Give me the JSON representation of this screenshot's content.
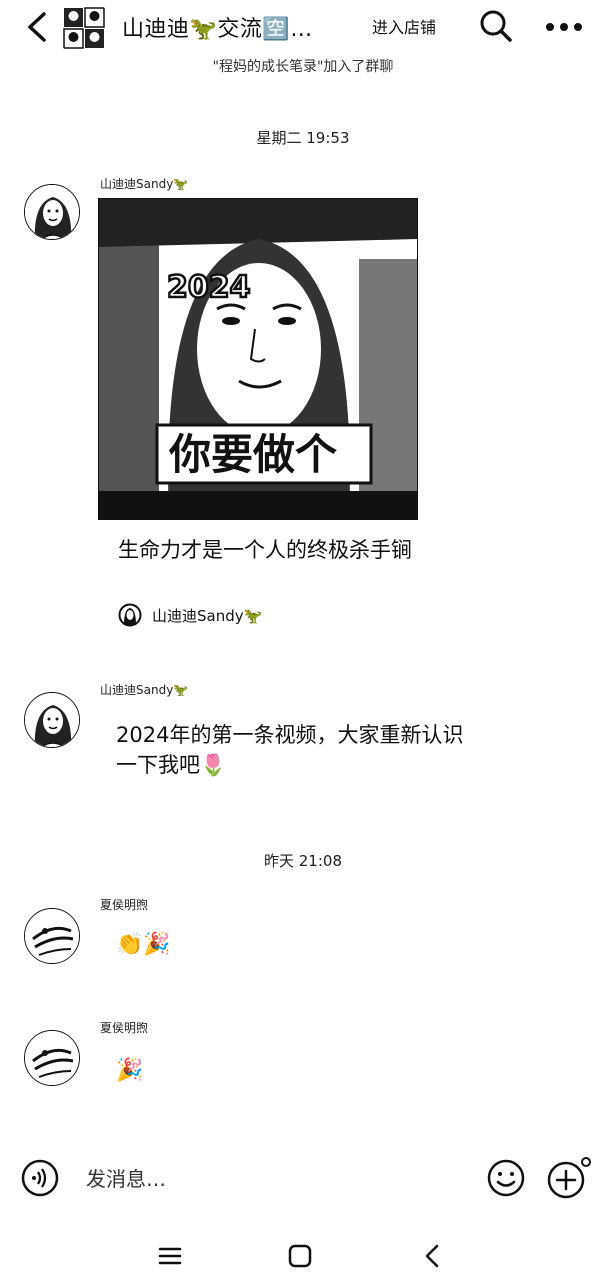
{
  "header": {
    "title": "山迪迪🦖交流🈳…",
    "store_button": "进入店铺",
    "icons": [
      "back-icon",
      "search-icon",
      "more-icon"
    ]
  },
  "join_notice": "\"程妈的成长笔录\"加入了群聊",
  "messages": [
    {
      "timestamp": "星期二 19:53",
      "sender": "山迪迪Sandy🦖",
      "type": "video-card",
      "card_overlay_year": "2024",
      "card_overlay_text": "你要做个",
      "card_caption": "生命力才是一个人的终极杀手锏",
      "card_author": "山迪迪Sandy🦖"
    },
    {
      "sender": "山迪迪Sandy🦖",
      "type": "text",
      "text": "2024年的第一条视频，大家重新认识一下我吧🌷"
    },
    {
      "timestamp": "昨天 21:08",
      "sender": "夏侯明煦",
      "type": "emoji",
      "text": "👏🎉"
    },
    {
      "sender": "夏侯明煦",
      "type": "emoji",
      "text": "🎉"
    }
  ],
  "input_bar": {
    "placeholder": "发消息…",
    "icons": [
      "voice-icon",
      "emoji-icon",
      "plus-icon"
    ]
  },
  "nav_bar": {
    "icons": [
      "menu-icon",
      "home-icon",
      "back-nav-icon"
    ]
  }
}
